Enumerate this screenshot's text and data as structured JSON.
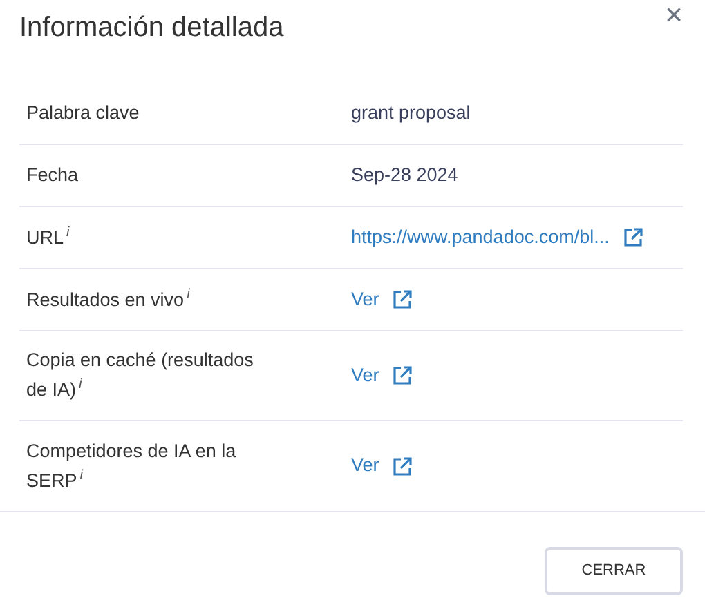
{
  "dialog": {
    "title": "Información detallada",
    "close": "×"
  },
  "rows": [
    {
      "label": "Palabra clave",
      "kind": "text",
      "value": "grant proposal"
    },
    {
      "label": "Fecha",
      "kind": "text",
      "value": "Sep-28 2024"
    },
    {
      "label": "URL",
      "info": "i",
      "kind": "link",
      "value": "https://www.pandadoc.com/bl..."
    },
    {
      "label": "Resultados en vivo",
      "info": "i",
      "kind": "link",
      "value": "Ver"
    },
    {
      "label": "Copia en caché (resultados de IA)",
      "info": "i",
      "kind": "link",
      "value": "Ver"
    },
    {
      "label": "Competidores de IA en la SERP",
      "info": "i",
      "kind": "link",
      "value": "Ver"
    }
  ],
  "buttons": [
    "CERRAR"
  ]
}
